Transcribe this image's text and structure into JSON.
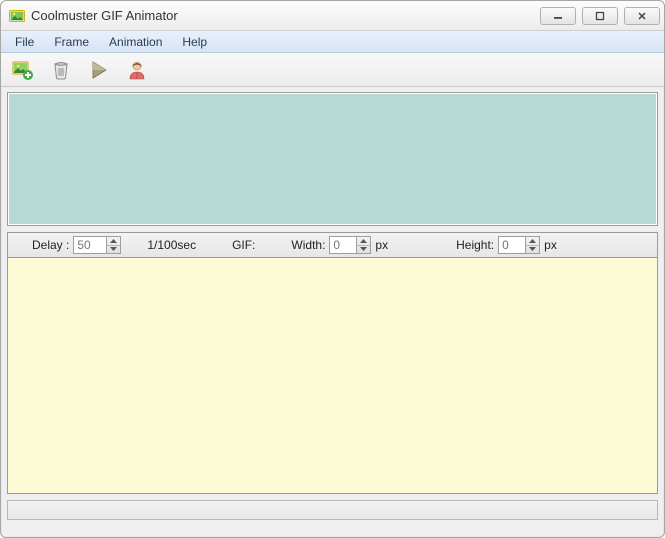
{
  "title": "Coolmuster GIF Animator",
  "menu": {
    "items": [
      "File",
      "Frame",
      "Animation",
      "Help"
    ]
  },
  "toolbar": {
    "icons": [
      {
        "name": "add-image-icon"
      },
      {
        "name": "delete-icon"
      },
      {
        "name": "play-icon"
      },
      {
        "name": "user-icon"
      }
    ]
  },
  "options": {
    "delay_label": "Delay :",
    "delay_value": "50",
    "delay_unit": "1/100sec",
    "gif_label": "GIF:",
    "width_label": "Width:",
    "width_value": "0",
    "px_unit": "px",
    "height_label": "Height:",
    "height_value": "0"
  }
}
